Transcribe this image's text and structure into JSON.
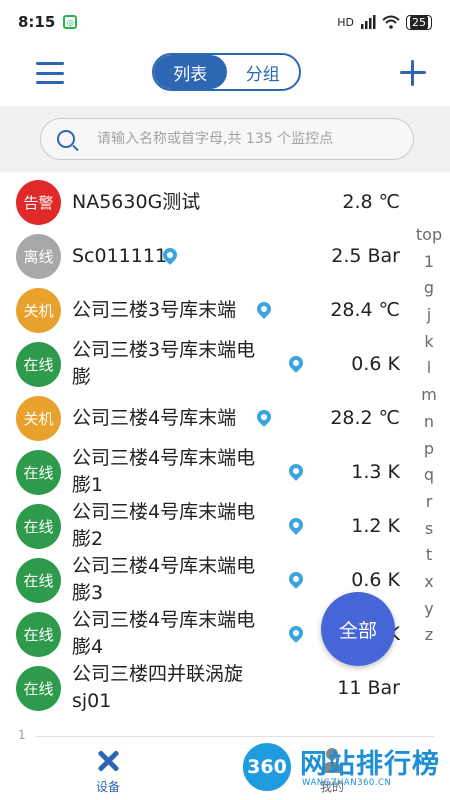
{
  "status_bar": {
    "time": "8:15",
    "app_icon_glyph": "◎",
    "signal_text": "HD",
    "battery": "25"
  },
  "header": {
    "tabs": [
      {
        "label": "列表",
        "active": true
      },
      {
        "label": "分组",
        "active": false
      }
    ]
  },
  "search": {
    "placeholder": "请输入名称或首字母,共 135 个监控点"
  },
  "colors": {
    "primary": "#2d66b3",
    "alarm": "#e02a2a",
    "offline": "#a8a8ab",
    "shutdown": "#e8a12c",
    "online": "#2e9a4c",
    "fab": "#4665d6",
    "pin": "#3aa6dd"
  },
  "devices": [
    {
      "status": "告警",
      "status_type": "alarm",
      "name_lines": [
        "NA5630G测试"
      ],
      "has_pin": false,
      "value": "2.8 ℃"
    },
    {
      "status": "离线",
      "status_type": "offline",
      "name_lines": [
        "Sc011111"
      ],
      "has_pin": true,
      "value": "2.5 Bar"
    },
    {
      "status": "关机",
      "status_type": "shutdown",
      "name_lines": [
        "公司三楼3号库末端"
      ],
      "has_pin": true,
      "value": "28.4 ℃"
    },
    {
      "status": "在线",
      "status_type": "online",
      "name_lines": [
        "公司三楼3号库末端电",
        "膨"
      ],
      "has_pin": true,
      "value": "0.6 K"
    },
    {
      "status": "关机",
      "status_type": "shutdown",
      "name_lines": [
        "公司三楼4号库末端"
      ],
      "has_pin": true,
      "value": "28.2 ℃"
    },
    {
      "status": "在线",
      "status_type": "online",
      "name_lines": [
        "公司三楼4号库末端电",
        "膨1"
      ],
      "has_pin": true,
      "value": "1.3 K"
    },
    {
      "status": "在线",
      "status_type": "online",
      "name_lines": [
        "公司三楼4号库末端电",
        "膨2"
      ],
      "has_pin": true,
      "value": "1.2 K"
    },
    {
      "status": "在线",
      "status_type": "online",
      "name_lines": [
        "公司三楼4号库末端电",
        "膨3"
      ],
      "has_pin": true,
      "value": "0.6 K"
    },
    {
      "status": "在线",
      "status_type": "online",
      "name_lines": [
        "公司三楼4号库末端电",
        "膨4"
      ],
      "has_pin": true,
      "value": "K"
    },
    {
      "status": "在线",
      "status_type": "online",
      "name_lines": [
        "公司三楼四并联涡旋",
        "sj01"
      ],
      "has_pin": false,
      "value": "11 Bar"
    }
  ],
  "index_bar": [
    "top",
    "1",
    "g",
    "j",
    "k",
    "l",
    "m",
    "n",
    "p",
    "q",
    "r",
    "s",
    "t",
    "x",
    "y",
    "z"
  ],
  "fab": {
    "label": "全部"
  },
  "page_number": "1",
  "tabbar": {
    "device_label": "设备",
    "mine_label": "我的"
  },
  "watermark": {
    "logo": "360",
    "title": "网站排行榜",
    "url": "WANGZHAN360.CN"
  }
}
